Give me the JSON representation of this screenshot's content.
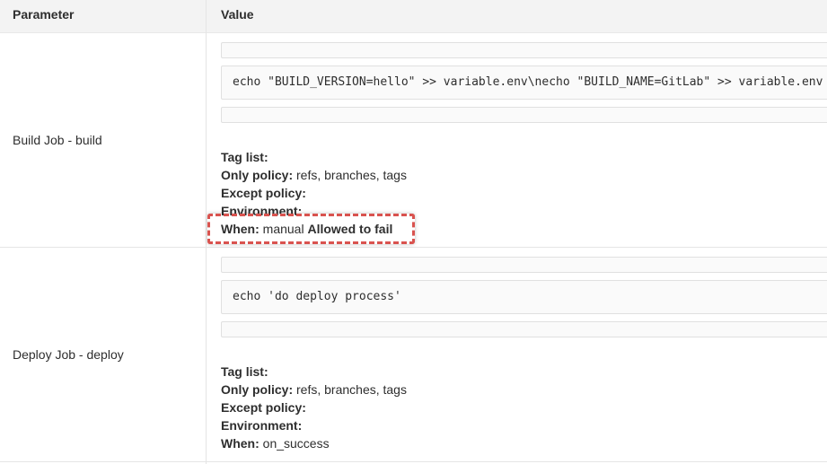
{
  "table": {
    "headers": {
      "parameter": "Parameter",
      "value": "Value"
    },
    "jobs": [
      {
        "name": "Build Job - build",
        "script": "echo \"BUILD_VERSION=hello\" >> variable.env\\necho \"BUILD_NAME=GitLab\" >> variable.env",
        "tag_list_label": "Tag list:",
        "tag_list_value": "",
        "only_policy_label": "Only policy:",
        "only_policy_value": "refs, branches, tags",
        "except_policy_label": "Except policy:",
        "except_policy_value": "",
        "environment_label": "Environment:",
        "environment_value": "",
        "when_label": "When:",
        "when_value": "manual",
        "allowed_to_fail": "Allowed to fail"
      },
      {
        "name": "Deploy Job - deploy",
        "script": "echo 'do deploy process'",
        "tag_list_label": "Tag list:",
        "tag_list_value": "",
        "only_policy_label": "Only policy:",
        "only_policy_value": "refs, branches, tags",
        "except_policy_label": "Except policy:",
        "except_policy_value": "",
        "environment_label": "Environment:",
        "environment_value": "",
        "when_label": "When:",
        "when_value": "on_success"
      }
    ]
  },
  "colors": {
    "header_bg": "#f3f3f3",
    "highlight": "#d9534f",
    "code_bg": "#fafafa"
  }
}
